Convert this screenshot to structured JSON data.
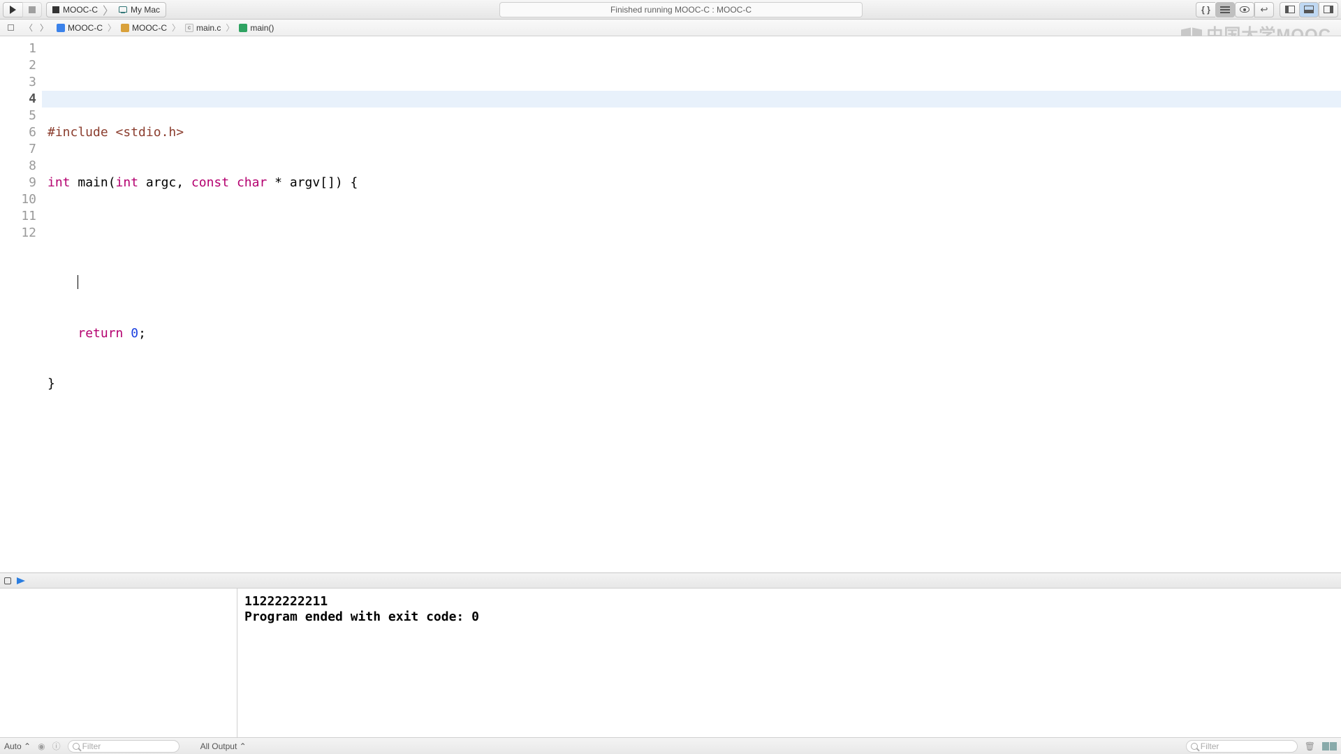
{
  "toolbar": {
    "scheme_project": "MOOC-C",
    "scheme_device": "My Mac",
    "status_text": "Finished running MOOC-C : MOOC-C"
  },
  "jumpbar": {
    "items": [
      {
        "label": "MOOC-C",
        "icon": "proj"
      },
      {
        "label": "MOOC-C",
        "icon": "fold"
      },
      {
        "label": "main.c",
        "icon": "c"
      },
      {
        "label": "main()",
        "icon": "func"
      }
    ]
  },
  "watermark": "中国大学MOOC",
  "editor": {
    "lines": 12,
    "highlight_line": 4,
    "tokens": {
      "l1a": "#include",
      "l1b": "<stdio.h>",
      "l2a": "int",
      "l2b": " main(",
      "l2c": "int",
      "l2d": " argc, ",
      "l2e": "const",
      "l2f": " ",
      "l2g": "char",
      "l2h": " * argv[]) {",
      "l4_indent": "    ",
      "l5a": "    ",
      "l5b": "return",
      "l5c": " ",
      "l5d": "0",
      "l5e": ";",
      "l6a": "}"
    }
  },
  "console": {
    "line1": "11222222211",
    "line2": "Program ended with exit code: 0"
  },
  "footer": {
    "auto_label": "Auto",
    "filter_placeholder": "Filter",
    "output_scope": "All Output"
  }
}
